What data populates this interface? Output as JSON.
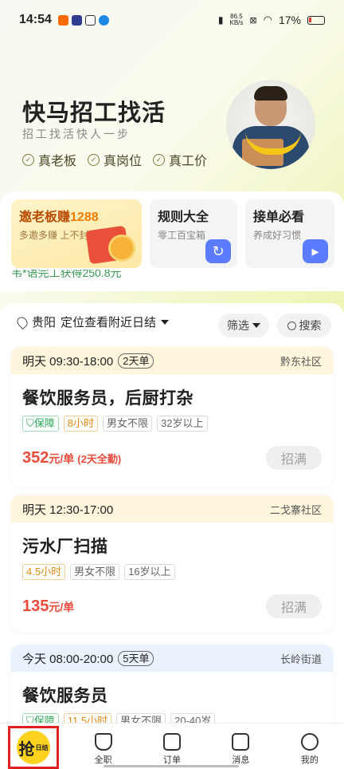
{
  "status": {
    "time": "14:54",
    "speed_value": "86.5",
    "speed_unit": "KB/s",
    "battery": "17%"
  },
  "hero": {
    "title": "快马招工找活",
    "slogan": "招工找活快人一步",
    "tags": [
      "真老板",
      "真岗位",
      "真工价"
    ]
  },
  "cards": {
    "invite": {
      "title": "邀老板赚",
      "amount": "1288",
      "sub": "多邀多赚 上不封顶"
    },
    "rules": {
      "title": "规则大全",
      "sub": "零工百宝箱"
    },
    "guide": {
      "title": "接单必看",
      "sub": "养成好习惯"
    }
  },
  "ticker": "韦*语完工获得250.8元",
  "filter_bar": {
    "city": "贵阳",
    "location_hint": "定位查看附近日结",
    "filter_label": "筛选",
    "search_label": "搜索"
  },
  "jobs": [
    {
      "time": "明天 09:30-18:00",
      "days": "2天单",
      "area": "黔东社区",
      "title": "餐饮服务员，后厨打杂",
      "tags": [
        "保障",
        "8小时",
        "男女不限",
        "32岁以上"
      ],
      "price": "352",
      "unit": "元/单",
      "extra": "(2天全勤)",
      "button": "招满"
    },
    {
      "time": "明天 12:30-17:00",
      "area": "二戈寨社区",
      "title": "污水厂扫描",
      "tags": [
        "4.5小时",
        "男女不限",
        "16岁以上"
      ],
      "price": "135",
      "unit": "元/单",
      "button": "招满"
    },
    {
      "time": "今天 08:00-20:00",
      "days": "5天单",
      "area": "长岭街道",
      "title": "餐饮服务员",
      "tags": [
        "保障",
        "11.5小时",
        "男女不限",
        "20-40岁"
      ]
    }
  ],
  "tabbar": {
    "grab": "抢",
    "grab_sub": "日结",
    "items": [
      "全职",
      "订单",
      "消息",
      "我的"
    ]
  }
}
